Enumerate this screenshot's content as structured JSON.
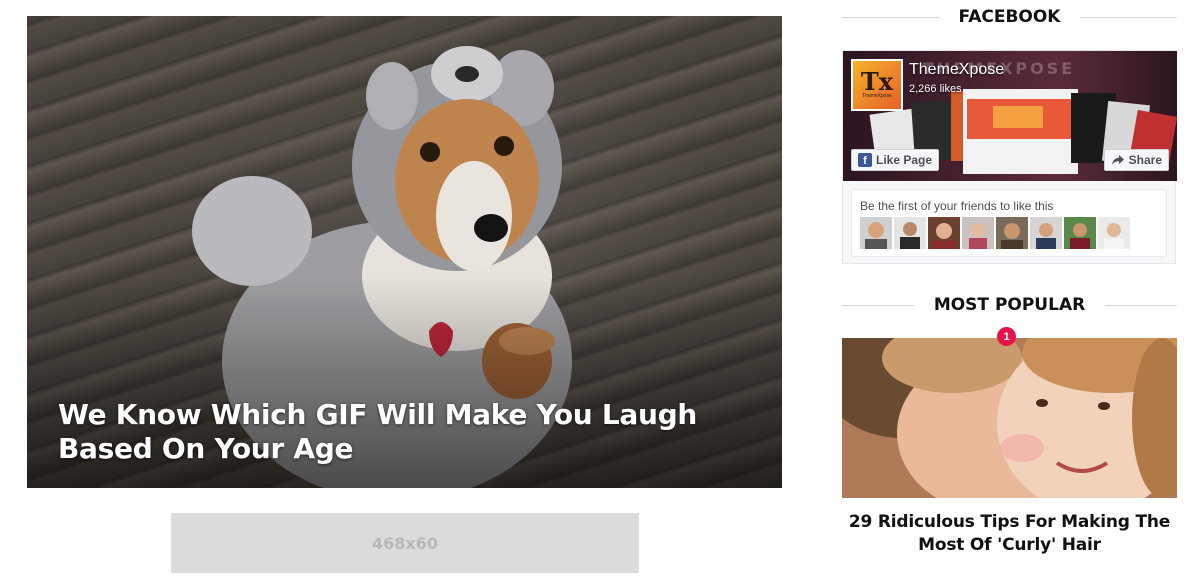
{
  "featured": {
    "title": "We Know Which GIF Will Make You Laugh Based On Your Age"
  },
  "ad": {
    "label": "468x60"
  },
  "facebook_widget": {
    "heading": "FACEBOOK",
    "page_name": "ThemeXpose",
    "likes": "2,266 likes",
    "logo_text": "Tx",
    "logo_subtext": "ThemeXpose",
    "cover_watermark": "THEMEXPOSE",
    "like_button": "Like Page",
    "share_button": "Share",
    "friends_text": "Be the first of your friends to like this",
    "friend_count": 8
  },
  "most_popular": {
    "heading": "MOST POPULAR",
    "rank": "1",
    "post_title": "29 Ridiculous Tips For Making The Most Of 'Curly' Hair"
  },
  "colors": {
    "accent": "#e8134b",
    "facebook_blue": "#3b5998"
  }
}
